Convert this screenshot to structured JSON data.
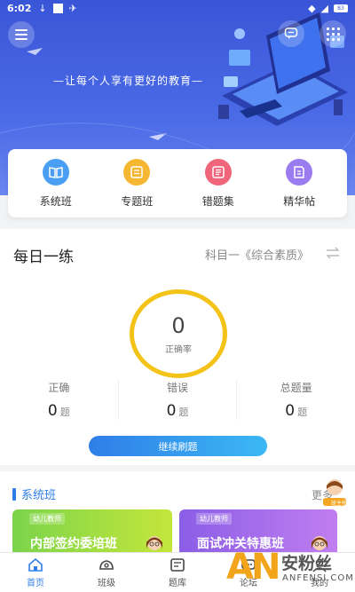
{
  "status_bar": {
    "time": "6:02",
    "battery": "83"
  },
  "hero": {
    "slogan": "—让每个人享有更好的教育—"
  },
  "categories": [
    {
      "label": "系统班",
      "icon": "book-icon",
      "color": "#4a9ff5"
    },
    {
      "label": "专题班",
      "icon": "list-icon",
      "color": "#f5b631"
    },
    {
      "label": "错题集",
      "icon": "error-book-icon",
      "color": "#f0657a"
    },
    {
      "label": "精华帖",
      "icon": "post-icon",
      "color": "#9a7cf0"
    }
  ],
  "daily": {
    "title": "每日一练",
    "subject": "科目一《综合素质》",
    "accuracy_value": "0",
    "accuracy_label": "正确率",
    "stats": [
      {
        "label": "正确",
        "value": "0",
        "unit": "题"
      },
      {
        "label": "错误",
        "value": "0",
        "unit": "题"
      },
      {
        "label": "总题量",
        "value": "0",
        "unit": "题"
      }
    ],
    "continue_label": "继续刷题"
  },
  "system_classes": {
    "title": "系统班",
    "more": "更多",
    "avatar_badge": "班主任",
    "courses": [
      {
        "tag": "幼儿教师",
        "name": "内部签约委培班"
      },
      {
        "tag": "幼儿教师",
        "name": "面试冲关特惠班"
      }
    ]
  },
  "tabs": [
    {
      "label": "首页",
      "icon": "home-icon",
      "active": true
    },
    {
      "label": "班级",
      "icon": "class-icon",
      "active": false
    },
    {
      "label": "题库",
      "icon": "question-bank-icon",
      "active": false
    },
    {
      "label": "论坛",
      "icon": "forum-icon",
      "active": false
    },
    {
      "label": "我的",
      "icon": "profile-icon",
      "active": false
    }
  ],
  "watermark": {
    "logo": "AN",
    "cn": "安粉丝",
    "en": "ANFENSI.COM"
  },
  "colors": {
    "primary": "#2f7ee8",
    "banner": "#3a56d8",
    "ring": "#f3c318"
  }
}
